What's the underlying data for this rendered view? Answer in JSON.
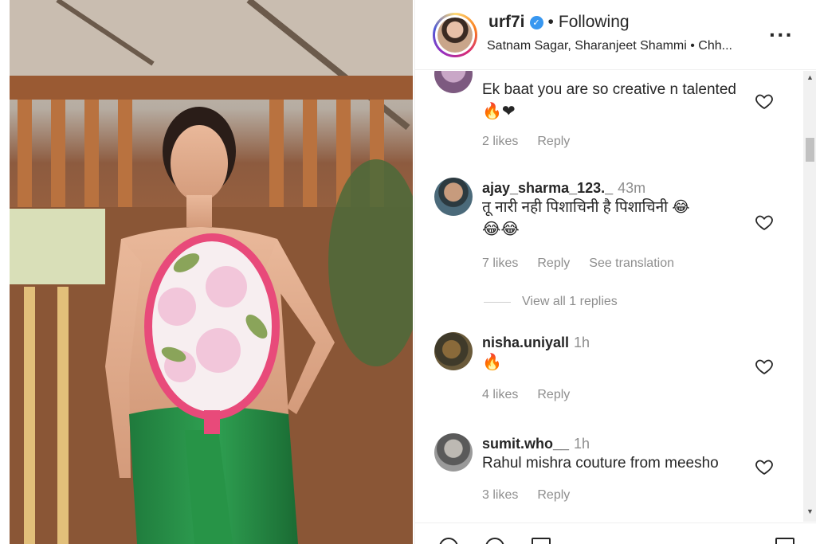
{
  "header": {
    "username": "urf7i",
    "verified_icon": "verified-badge-icon",
    "separator": "•",
    "follow_label": "Following",
    "subtitle": "Satnam Sagar, Sharanjeet Shammi • Chh...",
    "more_icon": "more-options-icon"
  },
  "comments": [
    {
      "username": "",
      "time": "",
      "text": "Ek baat you are so creative n talented",
      "emoji": "🔥❤",
      "likes": "2 likes",
      "reply": "Reply"
    },
    {
      "username": "ajay_sharma_123._",
      "time": "43m",
      "text": "तू नारी नही पिशाचिनी है पिशाचिनी 😂",
      "emoji": "😂😂",
      "likes": "7 likes",
      "reply": "Reply",
      "translate": "See translation",
      "view_replies": "View all 1 replies"
    },
    {
      "username": "nisha.uniyall",
      "time": "1h",
      "text": "",
      "emoji": "🔥",
      "likes": "4 likes",
      "reply": "Reply"
    },
    {
      "username": "sumit.who__",
      "time": "1h",
      "text": "Rahul mishra couture from meesho",
      "emoji": "",
      "likes": "3 likes",
      "reply": "Reply"
    }
  ],
  "icons": {
    "heart": "heart-icon",
    "scroll_up": "▲",
    "scroll_down": "▼"
  },
  "colors": {
    "verified": "#3897f0",
    "heart_red": "#ed4956",
    "flame": "#f26a1b"
  }
}
